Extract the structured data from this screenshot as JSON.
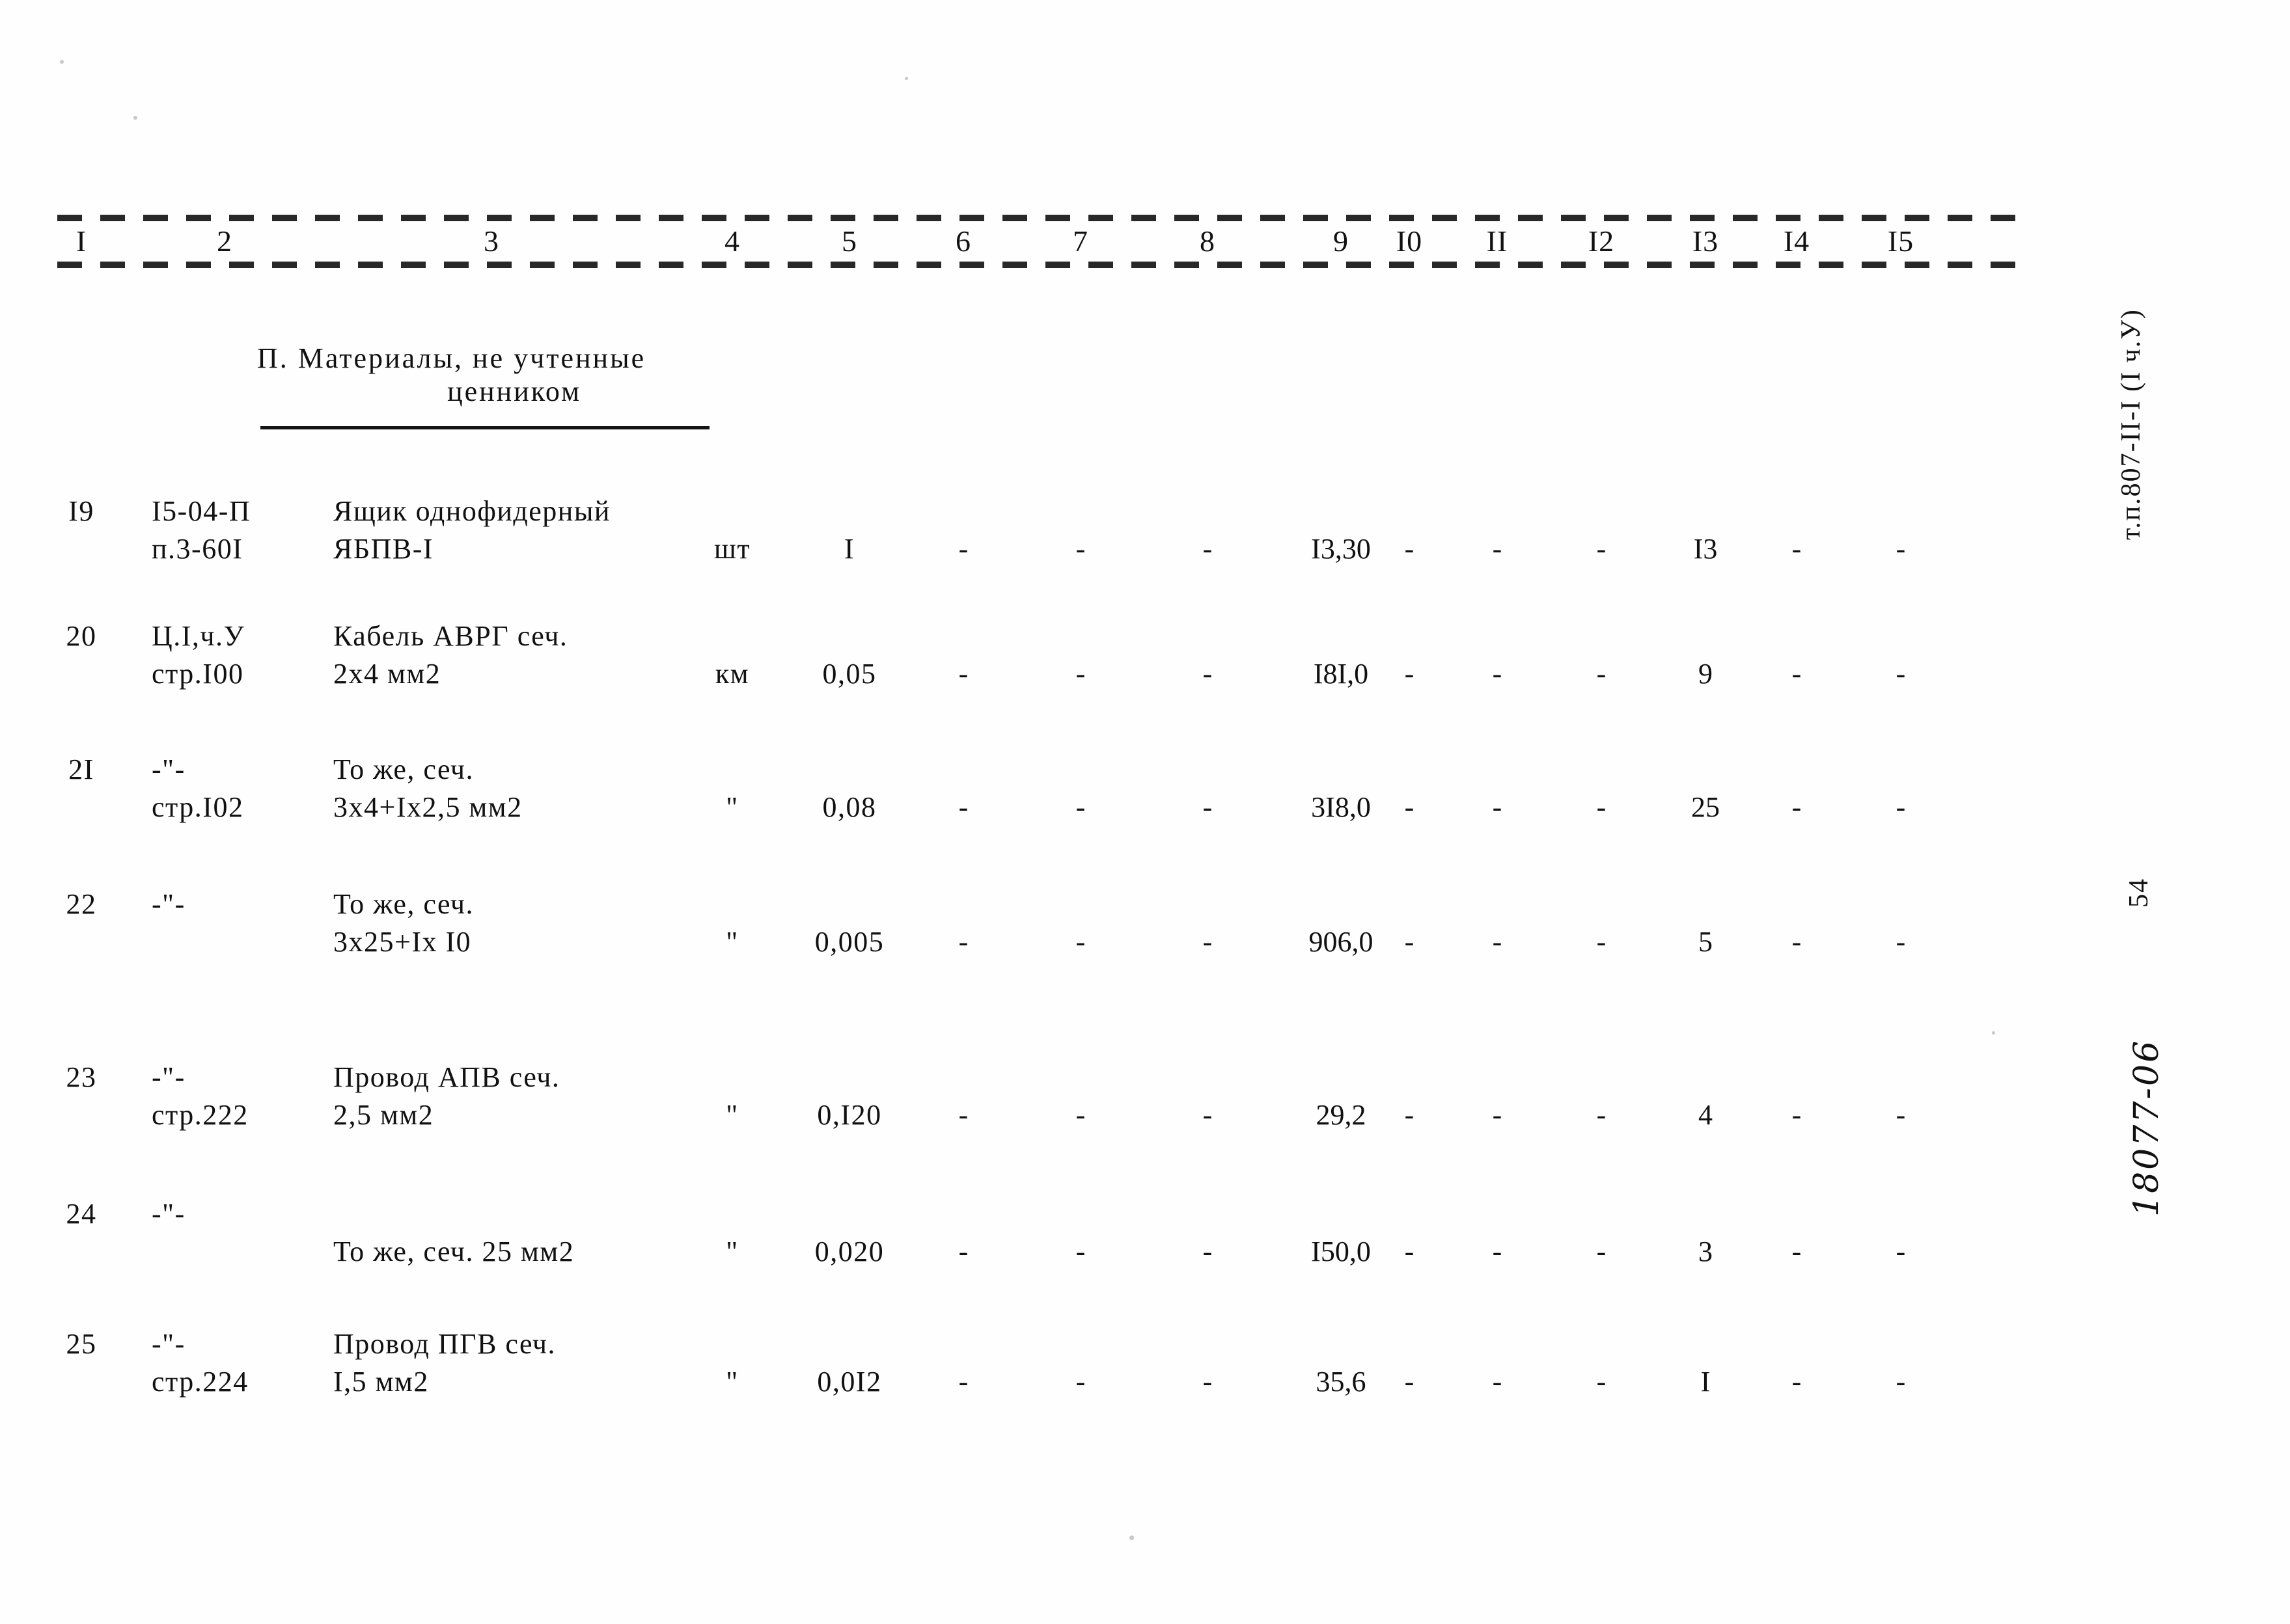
{
  "document": {
    "section_heading_line1": "П. Материалы, не учтенные",
    "section_heading_line2": "ценником",
    "margin_code": "т.п.807-II-I (I ч.У)",
    "margin_page": "54",
    "margin_stamp": "18077-06"
  },
  "table": {
    "column_numbers": [
      "I",
      "2",
      "3",
      "4",
      "5",
      "6",
      "7",
      "8",
      "9",
      "I0",
      "II",
      "I2",
      "I3",
      "I4",
      "I5"
    ],
    "rows": [
      {
        "num": "I9",
        "code_l1": "I5-04-П",
        "code_l2": "п.3-60I",
        "name_l1": "Ящик однофидерный",
        "name_l2": "ЯБПВ-I",
        "unit": "шт",
        "qty": "I",
        "c6": "-",
        "c7": "-",
        "c8": "-",
        "c9": "I3,30",
        "c10": "-",
        "c11": "-",
        "c12": "-",
        "c13": "I3",
        "c14": "-",
        "c15": "-"
      },
      {
        "num": "20",
        "code_l1": "Ц.I,ч.У",
        "code_l2": "стр.I00",
        "name_l1": "Кабель АВРГ сеч.",
        "name_l2": "2х4 мм2",
        "unit": "км",
        "qty": "0,05",
        "c6": "-",
        "c7": "-",
        "c8": "-",
        "c9": "I8I,0",
        "c10": "-",
        "c11": "-",
        "c12": "-",
        "c13": "9",
        "c14": "-",
        "c15": "-"
      },
      {
        "num": "2I",
        "code_l1": "-\"-",
        "code_l2": "стр.I02",
        "name_l1": "То же, сеч.",
        "name_l2": "3х4+Iх2,5 мм2",
        "unit": "\"",
        "qty": "0,08",
        "c6": "-",
        "c7": "-",
        "c8": "-",
        "c9": "3I8,0",
        "c10": "-",
        "c11": "-",
        "c12": "-",
        "c13": "25",
        "c14": "-",
        "c15": "-"
      },
      {
        "num": "22",
        "code_l1": "-\"-",
        "code_l2": "",
        "name_l1": "То же, сеч.",
        "name_l2": "3х25+Iх I0",
        "unit": "\"",
        "qty": "0,005",
        "c6": "-",
        "c7": "-",
        "c8": "-",
        "c9": "906,0",
        "c10": "-",
        "c11": "-",
        "c12": "-",
        "c13": "5",
        "c14": "-",
        "c15": "-"
      },
      {
        "num": "23",
        "code_l1": "-\"-",
        "code_l2": "стр.222",
        "name_l1": "Провод АПВ сеч.",
        "name_l2": "2,5 мм2",
        "unit": "\"",
        "qty": "0,I20",
        "c6": "-",
        "c7": "-",
        "c8": "-",
        "c9": "29,2",
        "c10": "-",
        "c11": "-",
        "c12": "-",
        "c13": "4",
        "c14": "-",
        "c15": "-"
      },
      {
        "num": "24",
        "code_l1": "-\"-",
        "code_l2": "",
        "name_l1": "",
        "name_l2": "То же, сеч. 25 мм2",
        "unit": "\"",
        "qty": "0,020",
        "c6": "-",
        "c7": "-",
        "c8": "-",
        "c9": "I50,0",
        "c10": "-",
        "c11": "-",
        "c12": "-",
        "c13": "3",
        "c14": "-",
        "c15": "-"
      },
      {
        "num": "25",
        "code_l1": "-\"-",
        "code_l2": "стр.224",
        "name_l1": "Провод ПГВ сеч.",
        "name_l2": "I,5 мм2",
        "unit": "\"",
        "qty": "0,0I2",
        "c6": "-",
        "c7": "-",
        "c8": "-",
        "c9": "35,6",
        "c10": "-",
        "c11": "-",
        "c12": "-",
        "c13": "I",
        "c14": "-",
        "c15": "-"
      }
    ]
  }
}
